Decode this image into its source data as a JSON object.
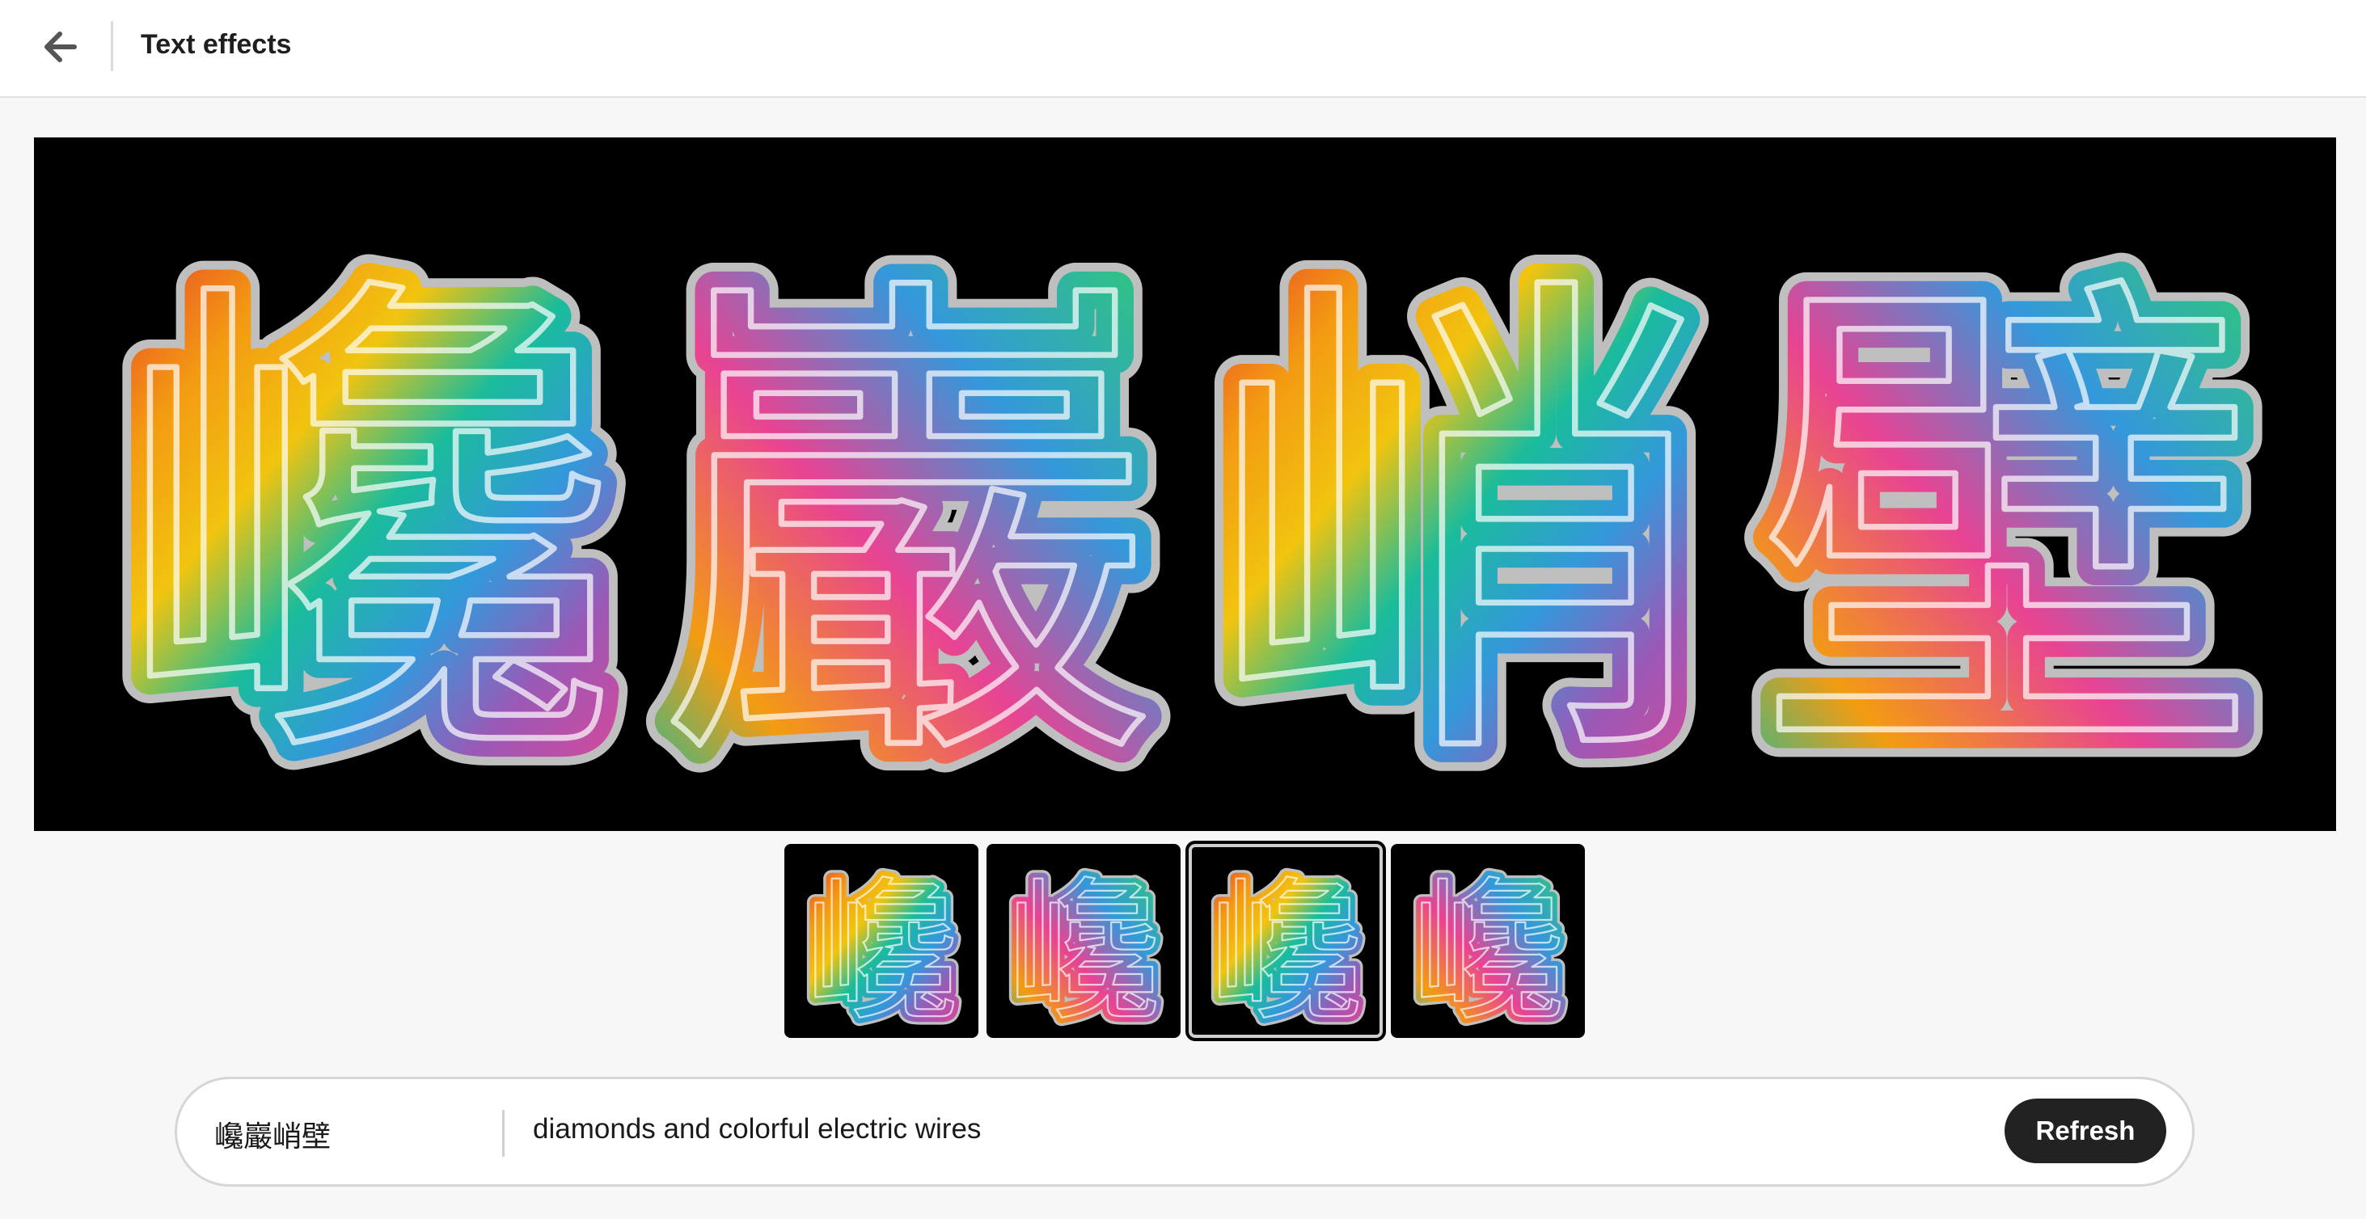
{
  "header": {
    "title": "Text effects",
    "back_icon": "arrow-left-icon"
  },
  "preview": {
    "characters": [
      "巉",
      "巖",
      "峭",
      "壁"
    ],
    "background": "#000000"
  },
  "thumbnails": [
    {
      "character": "巉",
      "selected": false
    },
    {
      "character": "巉",
      "selected": false
    },
    {
      "character": "巉",
      "selected": true
    },
    {
      "character": "巉",
      "selected": false
    }
  ],
  "prompt": {
    "text": "巉巖峭壁",
    "style": "diamonds and colorful electric wires",
    "refresh_label": "Refresh"
  },
  "colors": {
    "accent_button": "#222222",
    "effect_palette": [
      "#e8372a",
      "#f39c12",
      "#f1c40f",
      "#2ecc71",
      "#1abc9c",
      "#3498db",
      "#9b59b6",
      "#e84393",
      "#d9d9d9"
    ]
  }
}
